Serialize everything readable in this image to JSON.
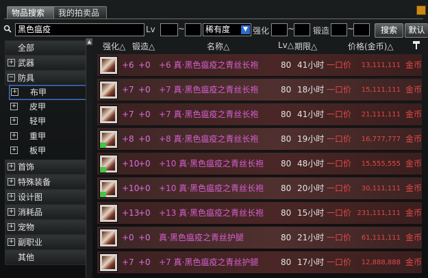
{
  "tabs": [
    "物品搜索",
    "我的拍卖品"
  ],
  "search": {
    "value": "黑色瘟疫",
    "lv_label": "Lv",
    "rarity_value": "稀有度",
    "enhance_label": "强化",
    "forge_label": "锻造",
    "search_button": "搜索",
    "default_button": "默认"
  },
  "sidebar": {
    "categories": [
      {
        "label": "全部",
        "expand": ""
      },
      {
        "label": "武器",
        "expand": "+"
      },
      {
        "label": "防具",
        "expand": "−"
      },
      {
        "label": "首饰",
        "expand": "+"
      },
      {
        "label": "特殊装备",
        "expand": "+"
      },
      {
        "label": "设计图",
        "expand": "+"
      },
      {
        "label": "消耗品",
        "expand": "+"
      },
      {
        "label": "宠物",
        "expand": "+"
      },
      {
        "label": "副职业",
        "expand": "+"
      },
      {
        "label": "其他",
        "expand": ""
      }
    ],
    "subcategories": [
      "布甲",
      "皮甲",
      "轻甲",
      "重甲",
      "板甲"
    ]
  },
  "table": {
    "headers": [
      "强化△",
      "锻造△",
      "名称△",
      "Lv△",
      "期限△",
      "价格(金币)△"
    ],
    "rows": [
      {
        "enh": "+6",
        "forge": "+0",
        "name": "+6 真·黑色瘟疫之青丝长袍",
        "lv": "80",
        "dur": "41小时",
        "type": "一口价",
        "price": "13,111,111",
        "coin": "金币"
      },
      {
        "enh": "+7",
        "forge": "+0",
        "name": "+7 真·黑色瘟疫之青丝长袍",
        "lv": "80",
        "dur": "18小时",
        "type": "一口价",
        "price": "15,111,111",
        "coin": "金币"
      },
      {
        "enh": "+7",
        "forge": "+0",
        "name": "+7 真·黑色瘟疫之青丝长袍",
        "lv": "80",
        "dur": "41小时",
        "type": "一口价",
        "price": "21,111,111",
        "coin": "金币"
      },
      {
        "enh": "+8",
        "forge": "+0",
        "name": "+8 真·黑色瘟疫之青丝长袍",
        "lv": "80",
        "dur": "19小时",
        "type": "一口价",
        "price": "16,777,777",
        "coin": "金币"
      },
      {
        "enh": "+10",
        "forge": "+0",
        "name": "+10 真·黑色瘟疫之青丝长袍",
        "lv": "80",
        "dur": "48小时",
        "type": "一口价",
        "price": "15,555,555",
        "coin": "金币"
      },
      {
        "enh": "+10",
        "forge": "+0",
        "name": "+10 真·黑色瘟疫之青丝长袍",
        "lv": "80",
        "dur": "20小时",
        "type": "一口价",
        "price": "30,111,111",
        "coin": "金币"
      },
      {
        "enh": "+13",
        "forge": "+0",
        "name": "+13 真·黑色瘟疫之青丝长袍",
        "lv": "80",
        "dur": "15小时",
        "type": "一口价",
        "price": "231,111,111",
        "coin": "金币"
      },
      {
        "enh": "+0",
        "forge": "+0",
        "name": "真·黑色瘟疫之青丝护腿",
        "lv": "80",
        "dur": "21小时",
        "type": "一口价",
        "price": "61,111,111",
        "coin": "金币"
      },
      {
        "enh": "+7",
        "forge": "+0",
        "name": "+7 真·黑色瘟疫之青丝护腿",
        "lv": "80",
        "dur": "17小时",
        "type": "一口价",
        "price": "12,888,888",
        "coin": "金币"
      }
    ]
  },
  "colors": {
    "accent": "#d65fd0",
    "price": "#e34848",
    "selected_border": "#4a76c8"
  },
  "icons": [
    "search-icon",
    "hammer-icon",
    "dropdown-arrow-icon",
    "scroll-up-icon",
    "corner-orange-icon",
    "item-robe-icon"
  ]
}
